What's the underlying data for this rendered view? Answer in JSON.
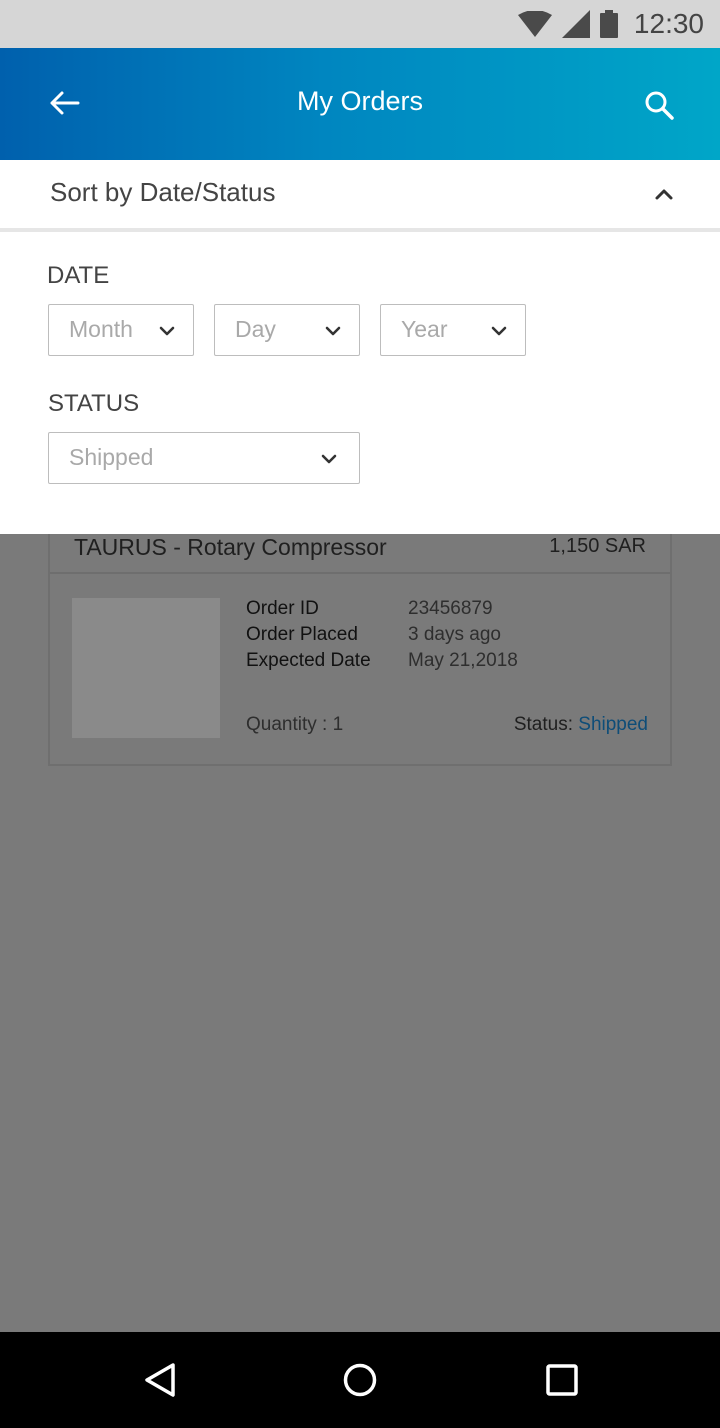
{
  "status_bar": {
    "time": "12:30",
    "icons": [
      "wifi-icon",
      "signal-icon",
      "battery-icon"
    ]
  },
  "app_bar": {
    "title": "My Orders",
    "back_icon": "arrow-left-icon",
    "search_icon": "search-icon"
  },
  "sort": {
    "title": "Sort by Date/Status",
    "toggle_icon": "chevron-up-icon"
  },
  "filters": {
    "date_label": "DATE",
    "month": "Month",
    "day": "Day",
    "year": "Year",
    "status_label": "STATUS",
    "status_value": "Shipped"
  },
  "order": {
    "title": "TAURUS - Rotary Compressor",
    "price": "1,150 SAR",
    "details": [
      {
        "label": "Order ID",
        "value": "23456879"
      },
      {
        "label": "Order Placed",
        "value": "3 days ago"
      },
      {
        "label": "Expected Date",
        "value": "May 21,2018"
      }
    ],
    "quantity": "Quantity : 1",
    "status_label": "Status: ",
    "status_value": "Shipped"
  },
  "nav_bar": {
    "icons": [
      "back-triangle-icon",
      "home-circle-icon",
      "recents-square-icon"
    ]
  },
  "colors": {
    "app_bar_start": "#0060ad",
    "app_bar_end": "#00a6c8",
    "overlay": "#7a7a7a",
    "status_link": "#0e4d78"
  }
}
